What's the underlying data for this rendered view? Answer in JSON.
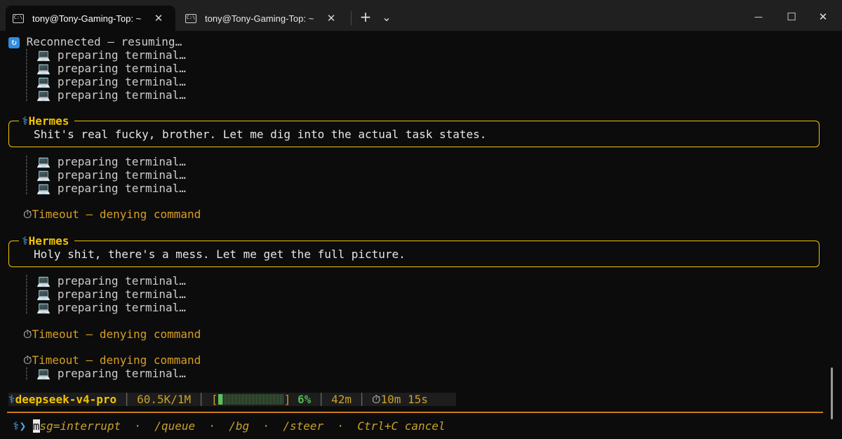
{
  "window": {
    "tabs": [
      {
        "title": "tony@Tony-Gaming-Top: ~",
        "icon": "terminal-icon",
        "active": true
      },
      {
        "title": "tony@Tony-Gaming-Top: ~",
        "icon": "terminal-icon",
        "active": false
      }
    ],
    "new_tab": "+",
    "dropdown": "⌄",
    "minimize": "—",
    "maximize": "☐",
    "close": "✕",
    "tab_close": "✕"
  },
  "terminal": {
    "reconnect_icon": "↻",
    "reconnect_text": "Reconnected — resuming…",
    "preparing_text": "preparing terminal…",
    "computer_icon": "💻",
    "stopwatch_icon": "⏱",
    "timeout_text": "Timeout — denying command",
    "hermes_icon": "⚕",
    "hermes_name": "Hermes",
    "messages": [
      "Shit's real fucky, brother. Let me dig into the actual task states.",
      "Holy shit, there's a mess. Let me get the full picture."
    ]
  },
  "status": {
    "model": "deepseek-v4-pro",
    "tokens": "60.5K/1M",
    "context_percent_label": "6%",
    "context_fraction": 0.06,
    "elapsed": "42m",
    "timer": "10m 15s",
    "separator": "│"
  },
  "input": {
    "prompt_icon": "⚕❯",
    "cursor_char": "m",
    "hint": "sg=interrupt  ·  /queue  ·  /bg  ·  /steer  ·  Ctrl+C cancel"
  }
}
